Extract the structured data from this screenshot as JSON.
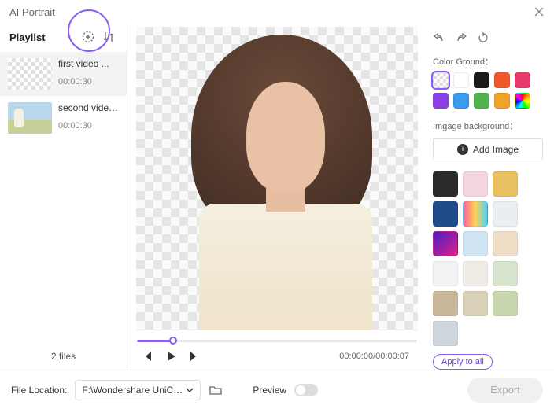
{
  "title": "AI Portrait",
  "sidebar": {
    "heading": "Playlist",
    "items": [
      {
        "name": "first video ...",
        "duration": "00:00:30"
      },
      {
        "name": "second video...",
        "duration": "00:00:30"
      }
    ],
    "file_count_label": "2 files"
  },
  "transport": {
    "time_current": "00:00:00",
    "time_total": "00:00:07"
  },
  "right": {
    "color_ground_label": "Color Ground：",
    "image_background_label": "Imgage background：",
    "add_image_label": "Add Image",
    "apply_label": "Apply to all",
    "swatches": [
      "none",
      "#ffffff",
      "#1a1a1a",
      "#f05a2a",
      "#e83a6a",
      "#8a3fe0",
      "#3a9bf0",
      "#4fb24a",
      "#f0a22a",
      "rainbow"
    ],
    "bg_thumbs": [
      "#2a2a2a",
      "#f4d6e0",
      "#e8c060",
      "#1f4b8a",
      "linear-gradient(90deg,#ff5ea0,#ffd34e,#4ed1ff)",
      "#e9eef3",
      "linear-gradient(135deg,#4a1fbf,#e01f8a)",
      "#cfe4f2",
      "#efddc5",
      "#f3f3f3",
      "#f0ede6",
      "#d7e5cf",
      "#c9b79b",
      "#d9d0b8",
      "#c8d6b0",
      "#cfd6dd"
    ]
  },
  "footer": {
    "location_label": "File Location:",
    "location_value": "F:\\Wondershare UniConverte...",
    "preview_label": "Preview",
    "export_label": "Export"
  }
}
